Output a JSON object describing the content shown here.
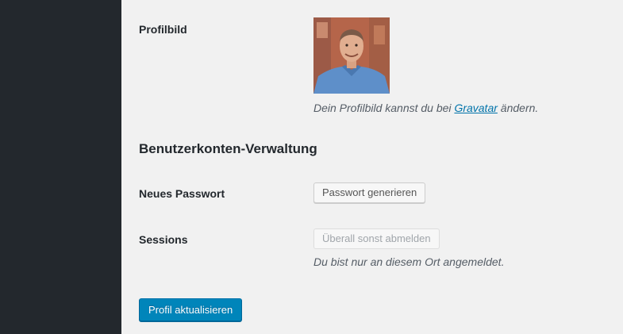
{
  "profile_picture": {
    "label": "Profilbild",
    "desc_before": "Dein Profilbild kannst du bei ",
    "desc_link": "Gravatar",
    "desc_after": " ändern."
  },
  "account_management": {
    "heading": "Benutzerkonten-Verwaltung",
    "new_password": {
      "label": "Neues Passwort",
      "button": "Passwort generieren"
    },
    "sessions": {
      "label": "Sessions",
      "button": "Überall sonst abmelden",
      "desc": "Du bist nur an diesem Ort angemeldet."
    }
  },
  "submit": {
    "label": "Profil aktualisieren"
  },
  "colors": {
    "sidebar": "#23282d",
    "background": "#f1f1f1",
    "primary": "#0085ba",
    "link": "#0073aa"
  }
}
